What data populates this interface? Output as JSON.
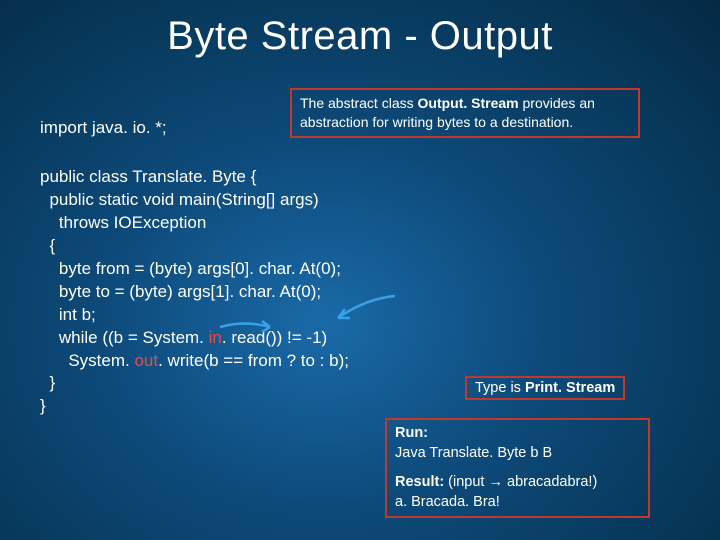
{
  "title": "Byte Stream - Output",
  "import_line": "import java. io. *;",
  "abstract_box": {
    "pre": "The abstract class ",
    "bold": "Output. Stream",
    "post": " provides an abstraction for writing bytes to a destination."
  },
  "code": {
    "l1": "public class Translate. Byte {",
    "l2": "  public static void main(String[] args)",
    "l3": "    throws IOException",
    "l4": "  {",
    "l5": "    byte from = (byte) args[0]. char. At(0);",
    "l6": "    byte to = (byte) args[1]. char. At(0);",
    "l7": "    int b;",
    "l8a": "    while ((b = System. ",
    "l8b": "in",
    "l8c": ". read()) != -1)",
    "l9a": "      System. ",
    "l9b": "out",
    "l9c": ". write(b == from ? to : b);",
    "l10": "  }",
    "l11": "}"
  },
  "type_box": {
    "pre": "Type is ",
    "bold": "Print. Stream"
  },
  "run_box": {
    "run_label": "Run:",
    "run_cmd": "Java Translate. Byte b B",
    "result_label": "Result:",
    "result_hint": " (input → abracadabra!)",
    "result_out": "a. Bracada. Bra!"
  }
}
